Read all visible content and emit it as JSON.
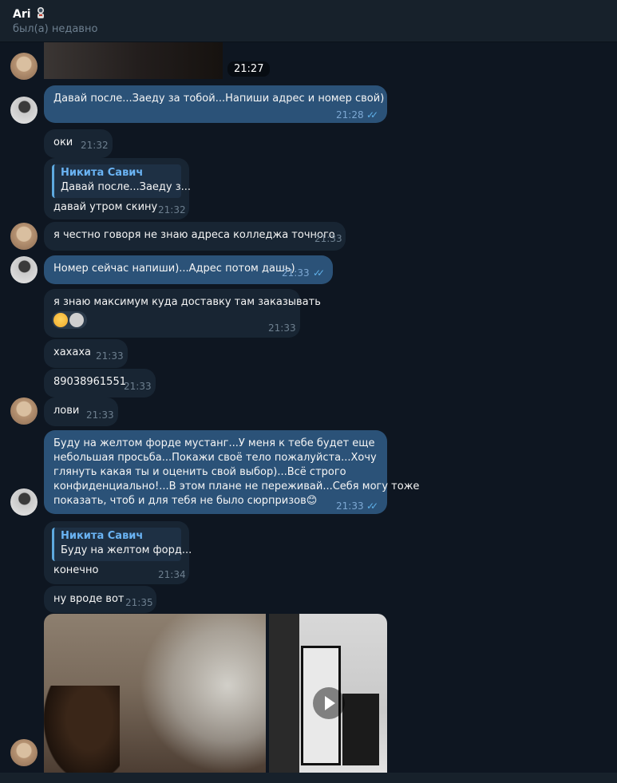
{
  "header": {
    "name": "Ari",
    "status": "был(а) недавно"
  },
  "first_time": "21:27",
  "messages": [
    {
      "text": "Давай после...Заеду за тобой...Напиши адрес и номер свой)",
      "time": "21:28"
    },
    {
      "text": "оки",
      "time": "21:32"
    },
    {
      "reply_name": "Никита Савич",
      "reply_text": "Давай после...Заеду з...",
      "text": "давай утром скину",
      "time": "21:32"
    },
    {
      "text": "я честно говоря не знаю адреса колледжа точного",
      "time": "21:33"
    },
    {
      "text": "Номер сейчас напиши)...Адрес потом дашь)",
      "time": "21:33"
    },
    {
      "text": "я знаю максимум куда доставку там заказывать",
      "time": "21:33"
    },
    {
      "text": "хахаха",
      "time": "21:33"
    },
    {
      "text": "89038961551",
      "time": "21:33"
    },
    {
      "text": "лови",
      "time": "21:33"
    },
    {
      "lines": [
        "Буду на желтом форде мустанг...У меня к тебе будет еще",
        "небольшая просьба...Покажи своё тело пожалуйста...Хочу",
        "глянуть какая ты и оценить свой выбор)...Всё строго",
        "конфиденциально!...В этом плане не переживай...Себя могу тоже",
        "показать, чтоб и для тебя не было сюрпризов😊"
      ],
      "time": "21:33"
    },
    {
      "reply_name": "Никита Савич",
      "reply_text": "Буду на желтом форд...",
      "text": "конечно",
      "time": "21:34"
    },
    {
      "text": "ну вроде вот",
      "time": "21:35"
    }
  ]
}
